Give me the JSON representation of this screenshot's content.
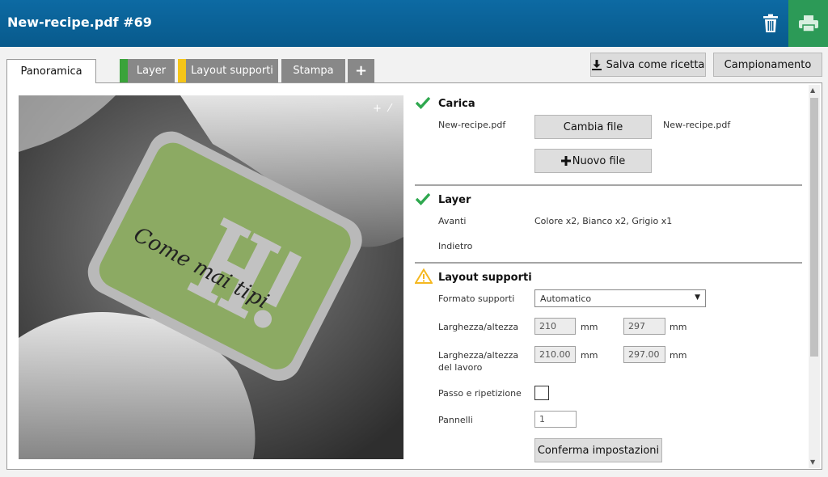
{
  "header": {
    "title": "New-recipe.pdf #69"
  },
  "tabs": [
    {
      "label": "Panoramica",
      "stripe": ""
    },
    {
      "label": "Layer",
      "stripe": "#3aa33a"
    },
    {
      "label": "Layout supporti",
      "stripe": "#f5c518"
    },
    {
      "label": "Stampa",
      "stripe": ""
    },
    {
      "label": "+",
      "stripe": ""
    }
  ],
  "actions": {
    "save_recipe": "Salva come ricetta",
    "sampling": "Campionamento"
  },
  "preview": {
    "handwriting": "Come mai tipi"
  },
  "carica": {
    "heading": "Carica",
    "file_label": "New-recipe.pdf",
    "change_button": "Cambia file",
    "file_value": "New-recipe.pdf",
    "new_file_button": "Nuovo file"
  },
  "layer": {
    "heading": "Layer",
    "front_label": "Avanti",
    "front_value": "Colore x2, Bianco x2, Grigio x1",
    "back_label": "Indietro"
  },
  "layout": {
    "heading": "Layout supporti",
    "format_label": "Formato supporti",
    "format_value": "Automatico",
    "size_label": "Larghezza/altezza",
    "width": "210",
    "height": "297",
    "unit": "mm",
    "job_size_label_1": "Larghezza/altezza",
    "job_size_label_2": "del lavoro",
    "job_width": "210.00",
    "job_height": "297.00",
    "step_repeat_label": "Passo e ripetizione",
    "panels_label": "Pannelli",
    "panels_value": "1",
    "confirm_button": "Conferma impostazioni"
  },
  "colors": {
    "header": "#085a8c",
    "print": "#2c9a57",
    "ok": "#2fa84f",
    "warn": "#f5b820"
  }
}
